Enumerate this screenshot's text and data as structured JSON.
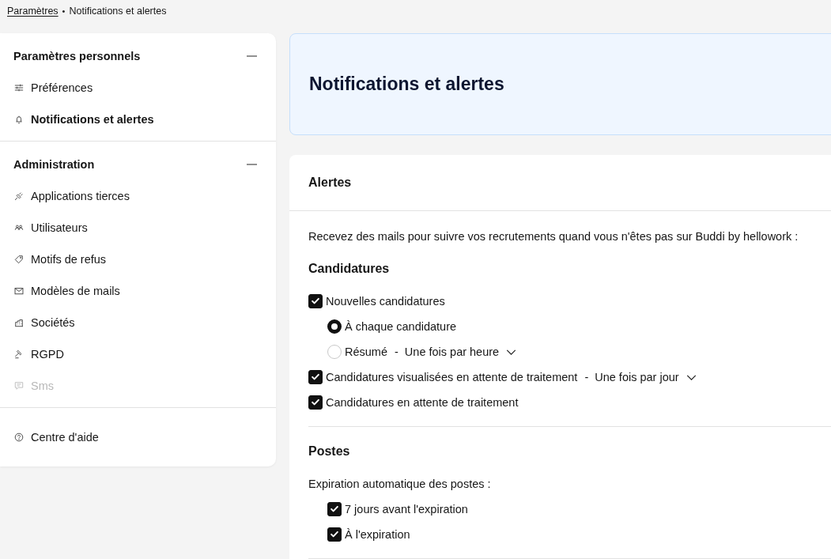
{
  "breadcrumb": {
    "separator": "•",
    "items": [
      {
        "label": "Paramètres",
        "kind": "link"
      },
      {
        "label": "Notifications et alertes",
        "kind": "current"
      }
    ]
  },
  "sidebar": {
    "sections": [
      {
        "title": "Paramètres personnels",
        "expanded": true,
        "items": [
          {
            "label": "Préférences",
            "selected": false,
            "disabled": false
          },
          {
            "label": "Notifications et alertes",
            "selected": true,
            "disabled": false
          }
        ]
      },
      {
        "title": "Administration",
        "expanded": true,
        "items": [
          {
            "label": "Applications tierces",
            "selected": false,
            "disabled": false
          },
          {
            "label": "Utilisateurs",
            "selected": false,
            "disabled": false
          },
          {
            "label": "Motifs de refus",
            "selected": false,
            "disabled": false
          },
          {
            "label": "Modèles de mails",
            "selected": false,
            "disabled": false
          },
          {
            "label": "Sociétés",
            "selected": false,
            "disabled": false
          },
          {
            "label": "RGPD",
            "selected": false,
            "disabled": false
          },
          {
            "label": "Sms",
            "selected": false,
            "disabled": true
          }
        ]
      }
    ],
    "help_link": {
      "label": "Centre d'aide"
    }
  },
  "page_header": {
    "title": "Notifications et alertes"
  },
  "alerts_card": {
    "title": "Alertes",
    "intro": "Recevez des mails pour suivre vos recrutements quand vous n'êtes pas sur Buddi by hellowork :",
    "sections": [
      {
        "title": "Candidatures",
        "options": [
          {
            "kind": "checkbox",
            "label": "Nouvelles candidatures",
            "checked": true,
            "children": [
              {
                "kind": "radio",
                "label": "À chaque candidature",
                "selected": true
              },
              {
                "kind": "radio",
                "label": "Résumé",
                "selected": false,
                "frequency": {
                  "separator": "-",
                  "value": "Une fois par heure"
                }
              }
            ]
          },
          {
            "kind": "checkbox",
            "label": "Candidatures visualisées en attente de traitement",
            "checked": true,
            "frequency": {
              "separator": "-",
              "value": "Une fois par jour"
            }
          },
          {
            "kind": "checkbox",
            "label": "Candidatures en attente de traitement",
            "checked": true
          }
        ]
      },
      {
        "title": "Postes",
        "options": [
          {
            "kind": "text",
            "label": "Expiration automatique des postes :",
            "children": [
              {
                "kind": "checkbox",
                "label": "7 jours avant l'expiration",
                "checked": true
              },
              {
                "kind": "checkbox",
                "label": "À l'expiration",
                "checked": true
              }
            ]
          }
        ]
      }
    ]
  }
}
